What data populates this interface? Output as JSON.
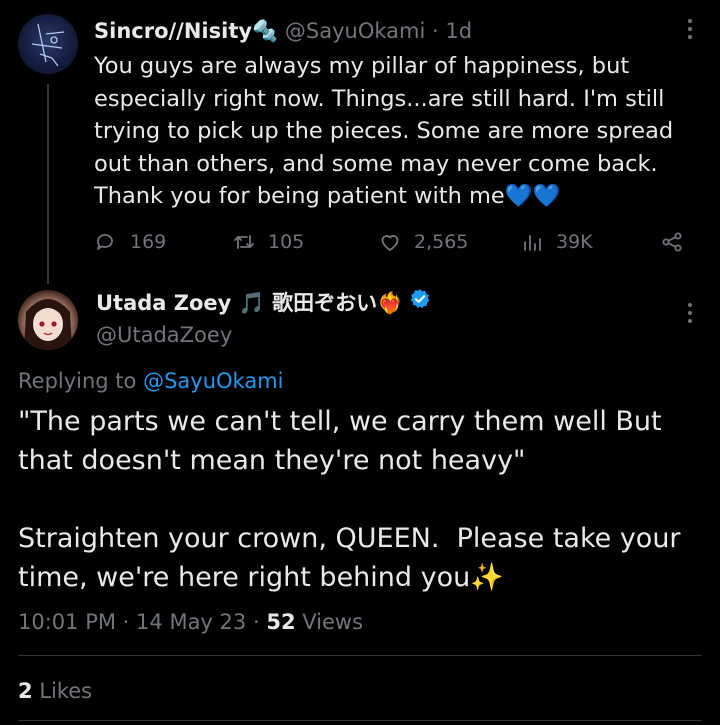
{
  "tweet": {
    "display_name": "Sincro//Nisity",
    "name_emoji": "🔩",
    "handle": "@SayuOkami",
    "separator": "·",
    "time_ago": "1d",
    "text": "You guys are always my pillar of happiness, but\nespecially right now. Things...are still hard. I'm still\ntrying to pick up the pieces. Some are more spread\nout than others, and some may never come back.\nThank you for being patient with me💙💙",
    "stats": {
      "replies": "169",
      "retweets": "105",
      "likes": "2,565",
      "views": "39K"
    }
  },
  "reply": {
    "display_name": "Utada Zoey 🎵 歌田ぞおい❤️‍🔥",
    "handle": "@UtadaZoey",
    "replying_prefix": "Replying to",
    "replying_handle": "@SayuOkami",
    "text": "\"The parts we can't tell, we carry them well But\nthat doesn't mean they're not heavy\"\n\nStraighten your crown, QUEEN.  Please take your\ntime, we're here right behind you✨",
    "time": "10:01 PM",
    "date": "14 May 23",
    "views_count": "52",
    "views_label": "Views",
    "likes_count": "2",
    "likes_label": "Likes"
  },
  "colors": {
    "background": "#000000",
    "text": "#e7e9ea",
    "muted": "#71767b",
    "accent": "#1d9bf0"
  }
}
